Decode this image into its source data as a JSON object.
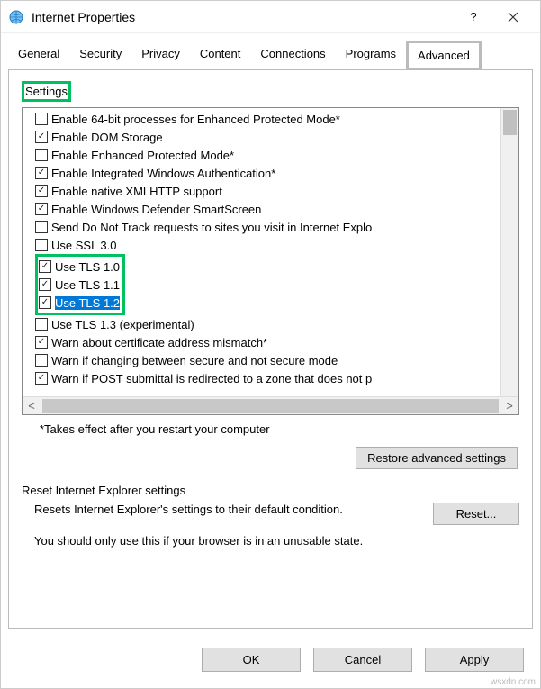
{
  "titlebar": {
    "title": "Internet Properties"
  },
  "tabs": [
    "General",
    "Security",
    "Privacy",
    "Content",
    "Connections",
    "Programs",
    "Advanced"
  ],
  "active_tab": "Advanced",
  "section_label": "Settings",
  "settings": [
    {
      "label": "Enable 64-bit processes for Enhanced Protected Mode*",
      "checked": false
    },
    {
      "label": "Enable DOM Storage",
      "checked": true
    },
    {
      "label": "Enable Enhanced Protected Mode*",
      "checked": false
    },
    {
      "label": "Enable Integrated Windows Authentication*",
      "checked": true
    },
    {
      "label": "Enable native XMLHTTP support",
      "checked": true
    },
    {
      "label": "Enable Windows Defender SmartScreen",
      "checked": true
    },
    {
      "label": "Send Do Not Track requests to sites you visit in Internet Explo",
      "checked": false
    },
    {
      "label": "Use SSL 3.0",
      "checked": false
    },
    {
      "label": "Use TLS 1.0",
      "checked": true,
      "hl": true
    },
    {
      "label": "Use TLS 1.1",
      "checked": true,
      "hl": true
    },
    {
      "label": "Use TLS 1.2",
      "checked": true,
      "hl": true,
      "selected": true
    },
    {
      "label": "Use TLS 1.3 (experimental)",
      "checked": false
    },
    {
      "label": "Warn about certificate address mismatch*",
      "checked": true
    },
    {
      "label": "Warn if changing between secure and not secure mode",
      "checked": false
    },
    {
      "label": "Warn if POST submittal is redirected to a zone that does not p",
      "checked": true
    }
  ],
  "footnote": "*Takes effect after you restart your computer",
  "restore_btn": "Restore advanced settings",
  "reset_group_label": "Reset Internet Explorer settings",
  "reset_text": "Resets Internet Explorer's settings to their default condition.",
  "reset_btn": "Reset...",
  "reset_warn": "You should only use this if your browser is in an unusable state.",
  "buttons": {
    "ok": "OK",
    "cancel": "Cancel",
    "apply": "Apply"
  },
  "watermark": "wsxdn.com"
}
